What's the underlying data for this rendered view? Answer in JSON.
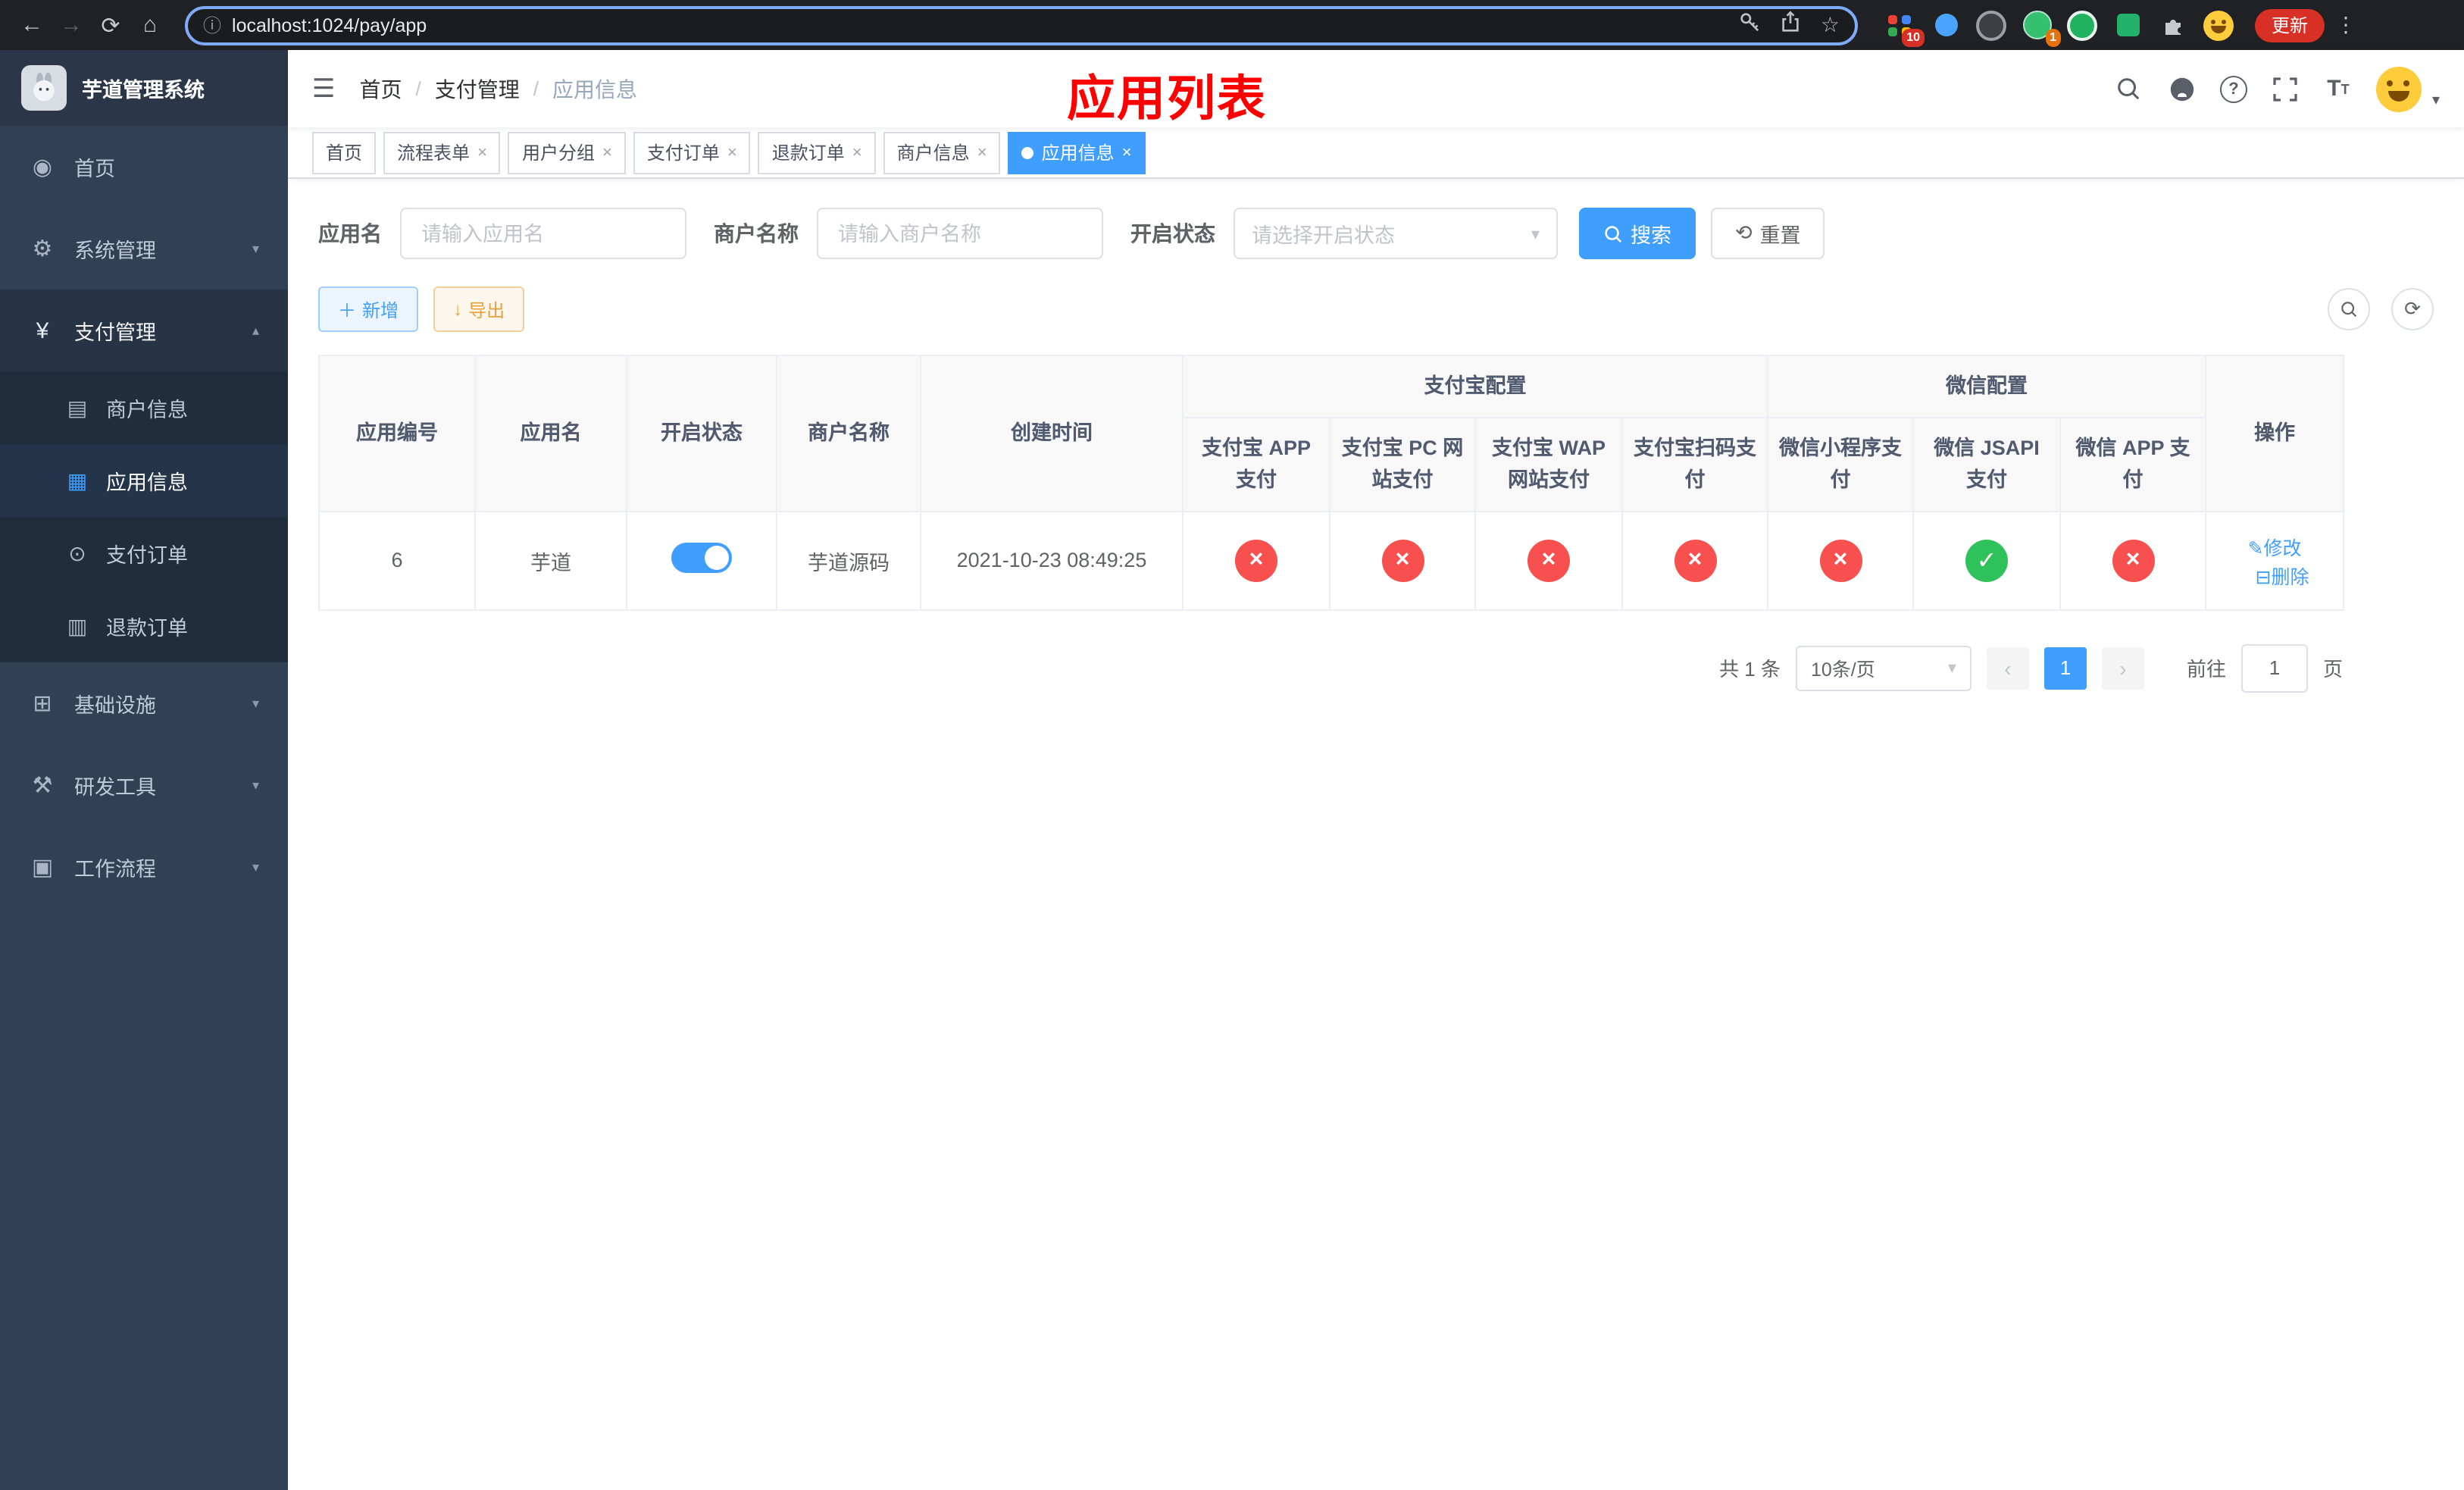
{
  "browser": {
    "url": "localhost:1024/pay/app",
    "update_label": "更新",
    "ext_badge_apps": "10",
    "ext_badge_avatar": "1"
  },
  "sidebar": {
    "title": "芋道管理系统",
    "items": [
      {
        "label": "首页"
      },
      {
        "label": "系统管理"
      },
      {
        "label": "支付管理"
      },
      {
        "label": "基础设施"
      },
      {
        "label": "研发工具"
      },
      {
        "label": "工作流程"
      }
    ],
    "submenu": [
      {
        "label": "商户信息"
      },
      {
        "label": "应用信息"
      },
      {
        "label": "支付订单"
      },
      {
        "label": "退款订单"
      }
    ]
  },
  "navbar": {
    "breadcrumb": [
      "首页",
      "支付管理",
      "应用信息"
    ],
    "separator": "/",
    "annotation": "应用列表"
  },
  "tabs": [
    {
      "label": "首页"
    },
    {
      "label": "流程表单"
    },
    {
      "label": "用户分组"
    },
    {
      "label": "支付订单"
    },
    {
      "label": "退款订单"
    },
    {
      "label": "商户信息"
    },
    {
      "label": "应用信息"
    }
  ],
  "filters": {
    "app_name_label": "应用名",
    "app_name_placeholder": "请输入应用名",
    "merchant_label": "商户名称",
    "merchant_placeholder": "请输入商户名称",
    "status_label": "开启状态",
    "status_placeholder": "请选择开启状态",
    "search_label": "搜索",
    "reset_label": "重置"
  },
  "toolbar": {
    "add_label": "新增",
    "export_label": "导出"
  },
  "table": {
    "headers": {
      "app_id": "应用编号",
      "app_name": "应用名",
      "status": "开启状态",
      "merchant": "商户名称",
      "created": "创建时间",
      "alipay_group": "支付宝配置",
      "wechat_group": "微信配置",
      "alipay_app": "支付宝 APP 支付",
      "alipay_pc": "支付宝 PC 网站支付",
      "alipay_wap": "支付宝 WAP 网站支付",
      "alipay_qr": "支付宝扫码支付",
      "wx_mini": "微信小程序支付",
      "wx_jsapi": "微信 JSAPI 支付",
      "wx_app": "微信 APP 支付",
      "ops": "操作"
    },
    "rows": [
      {
        "app_id": "6",
        "app_name": "芋道",
        "status_on": true,
        "merchant": "芋道源码",
        "created": "2021-10-23 08:49:25",
        "pay_status": [
          "no",
          "no",
          "no",
          "no",
          "no",
          "yes",
          "no"
        ],
        "edit_label": "修改",
        "delete_label": "删除"
      }
    ]
  },
  "pagination": {
    "total": "共 1 条",
    "page_size": "10条/页",
    "current_page": "1",
    "goto_prefix": "前往",
    "goto_value": "1",
    "goto_suffix": "页"
  },
  "colors": {
    "primary": "#409eff",
    "success": "#2fc25b",
    "danger": "#f7504f",
    "warning": "#e6a23c",
    "sidebar_bg": "#304156"
  }
}
